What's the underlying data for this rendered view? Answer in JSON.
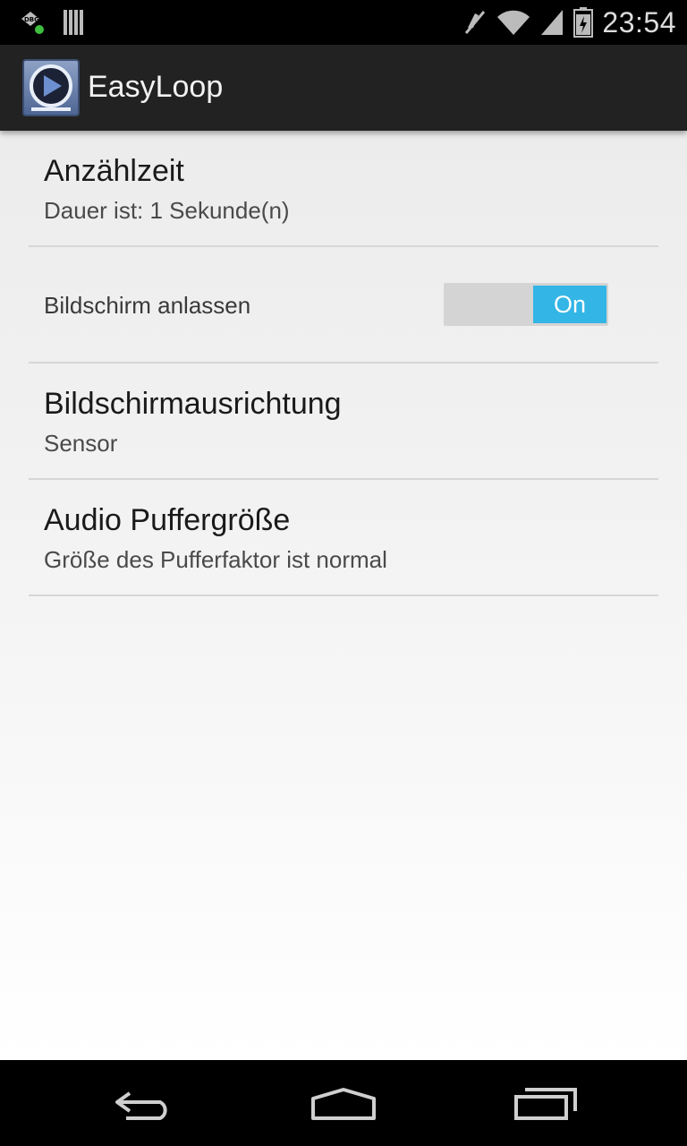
{
  "status_bar": {
    "time": "23:54",
    "left_icons": [
      "debug-notification-icon",
      "barcode-icon"
    ],
    "right_icons": [
      "muted-icon",
      "wifi-icon",
      "signal-icon",
      "battery-icon"
    ]
  },
  "action_bar": {
    "title": "EasyLoop",
    "logo_icon": "play-loop-icon"
  },
  "preferences": [
    {
      "title": "Anzählzeit",
      "summary": "Dauer ist: 1 Sekunde(n)"
    },
    {
      "label": "Bildschirm anlassen",
      "toggle": "On",
      "toggle_state": true
    },
    {
      "title": "Bildschirmausrichtung",
      "summary": "Sensor"
    },
    {
      "title": "Audio Puffergröße",
      "summary": "Größe des Pufferfaktor ist normal"
    }
  ],
  "nav_bar": {
    "icons": [
      "back-icon",
      "home-icon",
      "recent-apps-icon"
    ]
  },
  "colors": {
    "accent": "#33b5e5",
    "action_bar": "#222222"
  }
}
